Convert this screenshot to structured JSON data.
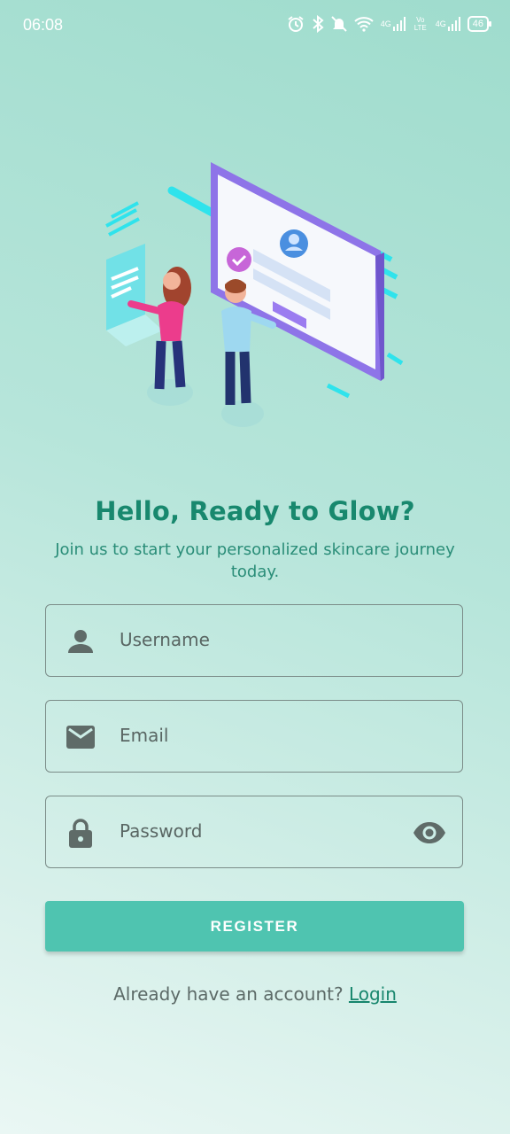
{
  "status_bar": {
    "time": "06:08",
    "network_1": "4G",
    "volte": "Vo LTE",
    "network_2": "4G",
    "battery": "46"
  },
  "content": {
    "title": "Hello, Ready to Glow?",
    "subtitle": "Join us to start your personalized skincare journey today."
  },
  "form": {
    "username_placeholder": "Username",
    "email_placeholder": "Email",
    "password_placeholder": "Password",
    "register_label": "REGISTER"
  },
  "footer": {
    "prompt": "Already have an account?",
    "login_label": "Login"
  },
  "colors": {
    "accent": "#4fc4b0",
    "title": "#18886e",
    "icon": "#5f6b68"
  }
}
